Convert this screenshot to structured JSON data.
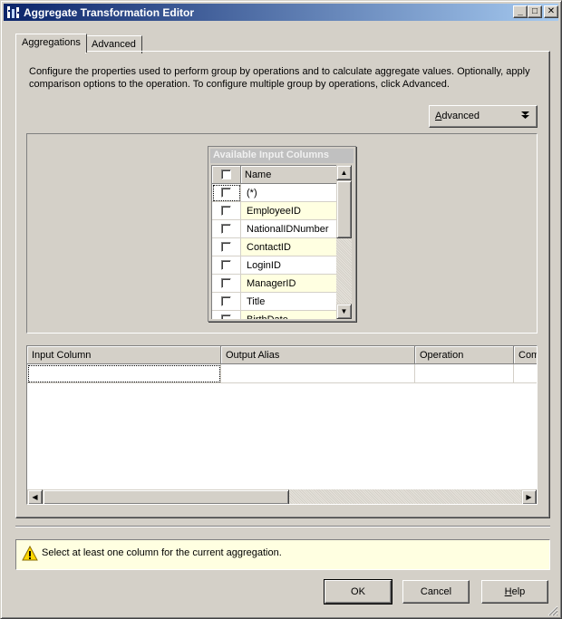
{
  "window": {
    "title": "Aggregate Transformation Editor",
    "min_glyph": "_",
    "max_glyph": "□",
    "close_glyph": "✕"
  },
  "tabs": [
    {
      "label": "Aggregations",
      "active": true
    },
    {
      "label": "Advanced",
      "active": false
    }
  ],
  "description": "Configure the properties used to perform group by operations and to calculate aggregate values. Optionally, apply comparison options to the operation. To configure multiple group by operations, click Advanced.",
  "advanced_button": {
    "label_pre": "",
    "label_mnemonic": "A",
    "label_post": "dvanced",
    "chevron": "⯯"
  },
  "available_columns": {
    "title": "Available Input Columns",
    "header": "Name",
    "rows": [
      "(*)",
      "EmployeeID",
      "NationalIDNumber",
      "ContactID",
      "LoginID",
      "ManagerID",
      "Title",
      "BirthDate"
    ]
  },
  "grid": {
    "columns": [
      "Input Column",
      "Output Alias",
      "Operation",
      "Comparison Flags"
    ]
  },
  "status": {
    "message": "Select at least one column for the current aggregation."
  },
  "buttons": {
    "ok": "OK",
    "cancel": "Cancel",
    "help_mnemonic": "H",
    "help_rest": "elp"
  },
  "colors": {
    "titlebar_start": "#0a246a",
    "titlebar_end": "#a6caf0",
    "row_alt": "#ffffe1",
    "status_bg": "#ffffe1"
  }
}
